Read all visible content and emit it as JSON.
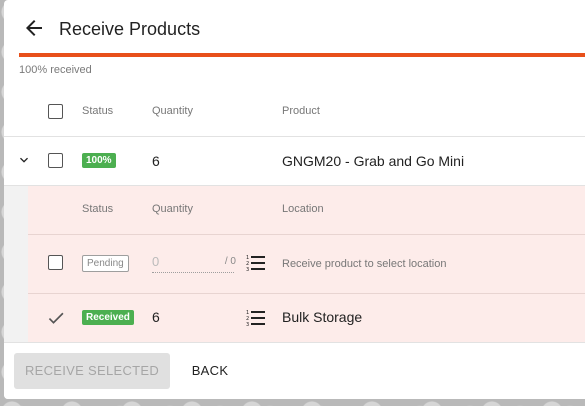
{
  "header": {
    "title": "Receive Products",
    "progress_percent": 100,
    "progress_label": "100% received"
  },
  "table": {
    "headers": {
      "status": "Status",
      "quantity": "Quantity",
      "product": "Product"
    },
    "row": {
      "badge": "100%",
      "quantity": "6",
      "product": "GNGM20 - Grab and Go Mini"
    }
  },
  "subtable": {
    "headers": {
      "status": "Status",
      "quantity": "Quantity",
      "location": "Location"
    },
    "pending": {
      "badge": "Pending",
      "quantity_value": "0",
      "quantity_max": "/ 0",
      "hint": "Receive product to select location"
    },
    "received": {
      "badge": "Received",
      "quantity": "6",
      "location": "Bulk Storage"
    }
  },
  "footer": {
    "receive_selected": "RECEIVE SELECTED",
    "back": "BACK"
  },
  "colors": {
    "accent": "#e8501a",
    "success": "#4caf50",
    "expanded_bg": "#fdecea"
  },
  "icons": {
    "back": "arrow-left-icon",
    "expand": "chevron-down-icon",
    "list": "list-numbered-icon",
    "check": "check-icon"
  }
}
